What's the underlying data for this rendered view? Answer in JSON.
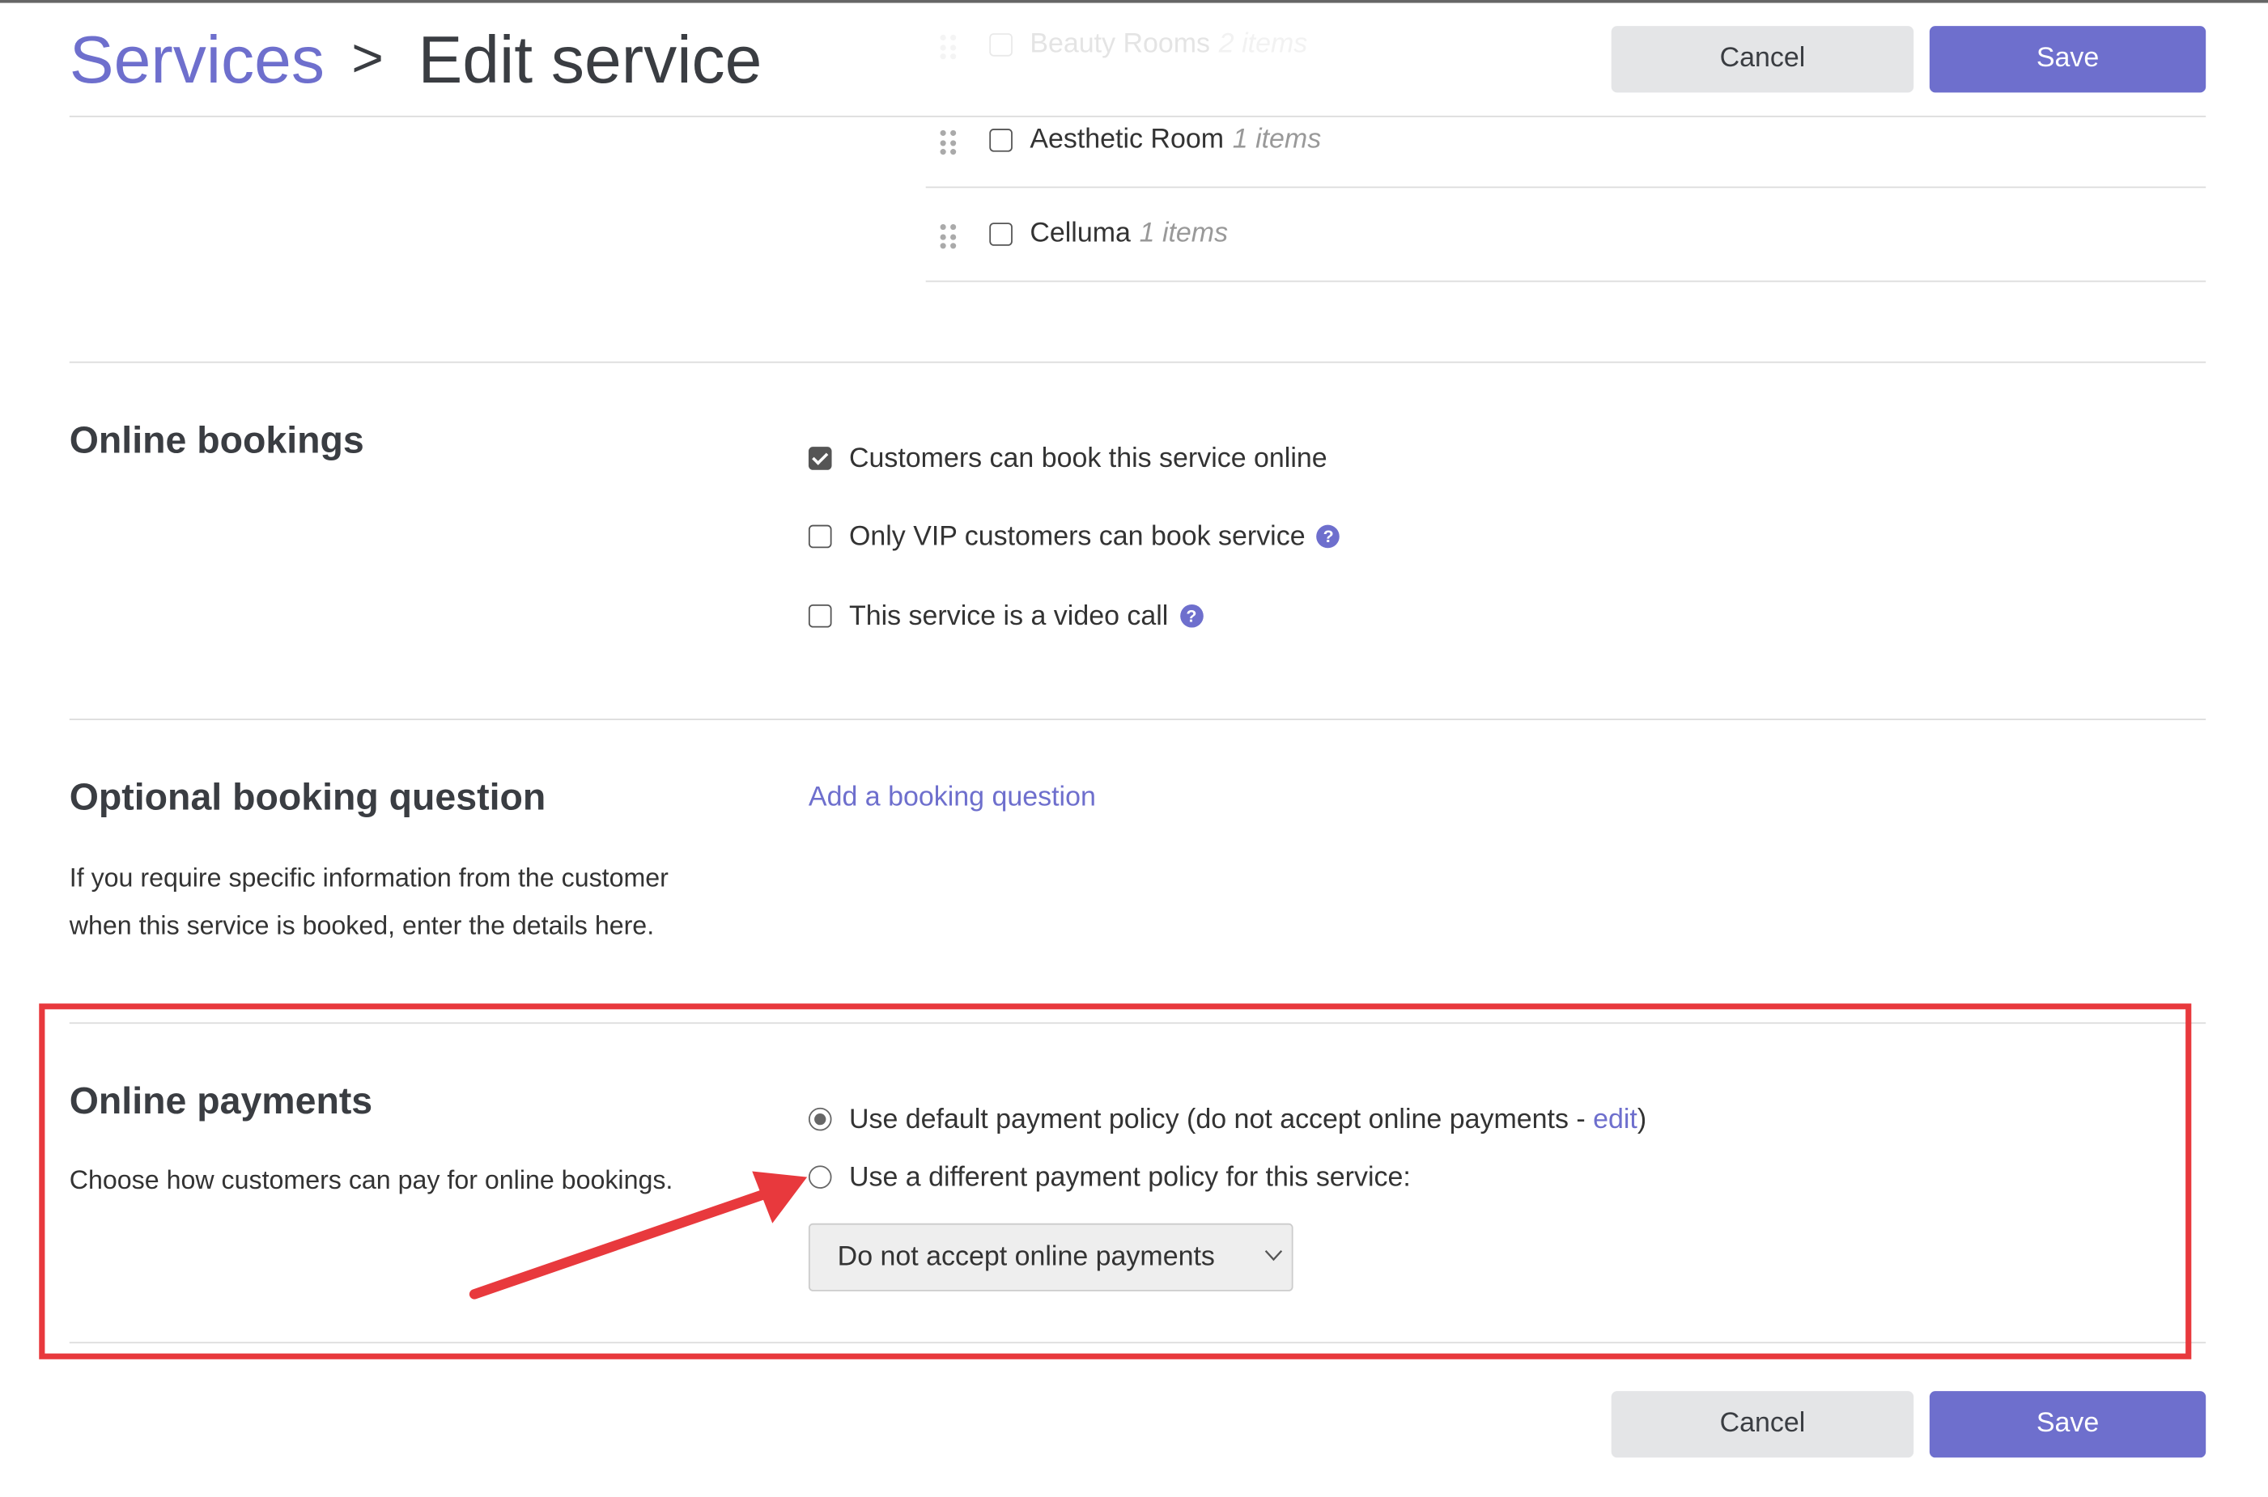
{
  "header": {
    "breadcrumb_parent": "Services",
    "separator": ">",
    "title": "Edit service",
    "cancel_label": "Cancel",
    "save_label": "Save"
  },
  "resource_groups": [
    {
      "name": "Beauty Rooms",
      "count": "2 items",
      "checked": false
    },
    {
      "name": "Aesthetic Room",
      "count": "1 items",
      "checked": false
    },
    {
      "name": "Celluma",
      "count": "1 items",
      "checked": false
    }
  ],
  "online_bookings": {
    "heading": "Online bookings",
    "options": [
      {
        "label": "Customers can book this service online",
        "checked": true
      },
      {
        "label": "Only VIP customers can book service",
        "checked": false,
        "help": "?"
      },
      {
        "label": "This service is a video call",
        "checked": false,
        "help": "?"
      }
    ]
  },
  "booking_question": {
    "heading": "Optional booking question",
    "description_line1": "If you require specific information from the customer",
    "description_line2": "when this service is booked, enter the details here.",
    "add_link": "Add a booking question"
  },
  "online_payments": {
    "heading": "Online payments",
    "description": "Choose how customers can pay for online bookings.",
    "option_default_prefix": "Use default payment policy (do not accept online payments - ",
    "option_default_link": "edit",
    "option_default_suffix": ")",
    "option_custom": "Use a different payment policy for this service:",
    "selected_option": "default",
    "select_value": "Do not accept online payments"
  },
  "annotation": {
    "highlight_color": "#e8393d"
  },
  "footer": {
    "cancel_label": "Cancel",
    "save_label": "Save"
  },
  "colors": {
    "accent": "#6e6fcd",
    "cancel_bg": "#e4e5e7"
  }
}
